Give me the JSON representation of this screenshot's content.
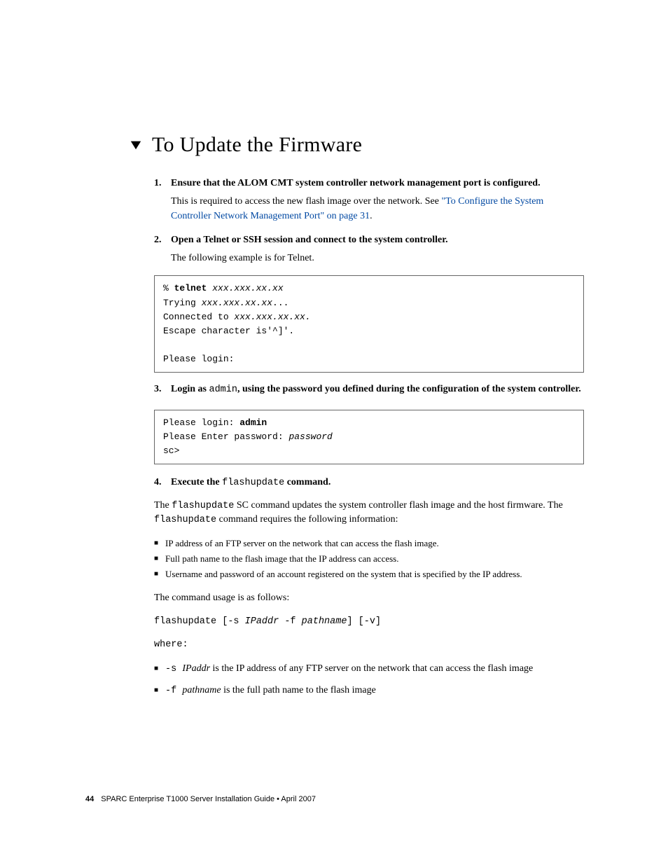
{
  "heading": "To Update the Firmware",
  "steps": {
    "s1": {
      "num": "1.",
      "bold": "Ensure that the ALOM CMT system controller network management port is configured.",
      "para_pre": "This is required to access the new flash image over the network. See ",
      "para_link": "\"To Configure the System Controller Network Management Port\" on page 31",
      "para_post": "."
    },
    "s2": {
      "num": "2.",
      "bold": "Open a Telnet or SSH session and connect to the system controller.",
      "para": "The following example is for Telnet."
    },
    "code1": {
      "prompt": "% ",
      "cmd": "telnet ",
      "arg": "xxx.xxx.xx.xx",
      "l2a": "Trying ",
      "l2b": "xxx.xxx.xx.xx",
      "l2c": "...",
      "l3a": "Connected to ",
      "l3b": "xxx.xxx.xx.xx.",
      "l4": "Escape character is'^]'.",
      "l5": "",
      "l6": "Please login:"
    },
    "s3": {
      "num": "3.",
      "bold_a": "Login as ",
      "code": "admin",
      "bold_b": ", using the password you defined during the configuration of the system controller."
    },
    "code2": {
      "l1a": "Please login: ",
      "l1b": "admin",
      "l2a": "Please Enter password: ",
      "l2b": "password",
      "l3": "sc>"
    },
    "s4": {
      "num": "4.",
      "bold_a": "Execute the ",
      "code": "flashupdate",
      "bold_b": " command."
    },
    "p4a": "The ",
    "p4b": "flashupdate",
    "p4c": " SC command updates the system controller flash image and the host firmware. The ",
    "p4d": "flashupdate",
    "p4e": " command requires the following information:",
    "bullets1": {
      "b1": "IP address of an FTP server on the network that can access the flash image.",
      "b2": "Full path name to the flash image that the IP address can access.",
      "b3": "Username and password of an account registered on the system that is specified by the IP address."
    },
    "p5": "The command usage is as follows:",
    "usage": {
      "a": "flashupdate [-s ",
      "b": "IPaddr",
      "c": " -f ",
      "d": "pathname",
      "e": "] [-v]"
    },
    "where": "where:",
    "bullets2": {
      "b1a": "-s ",
      "b1b": "IPaddr",
      "b1c": " is the IP address of any FTP server on the network that can access the flash image",
      "b2a": "-f ",
      "b2b": "pathname",
      "b2c": " is the full path name to the flash image"
    }
  },
  "footer": {
    "page": "44",
    "text": "SPARC Enterprise T1000 Server Installation Guide • April 2007"
  }
}
